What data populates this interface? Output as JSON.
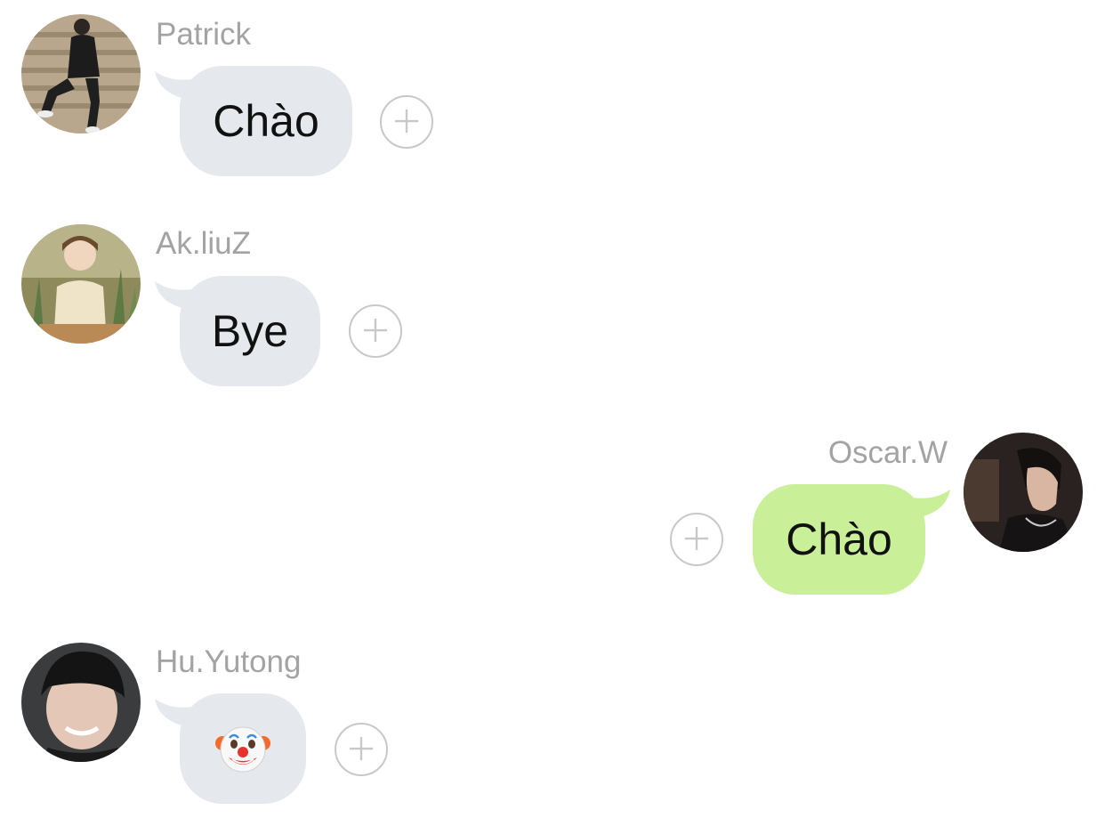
{
  "colors": {
    "incoming_bubble": "#e5e8ec",
    "outgoing_bubble": "#c9ef98",
    "sender_name": "#a3a3a3",
    "add_reaction_ring": "#c8c8c8"
  },
  "messages": [
    {
      "sender": "Patrick",
      "text": "Chào",
      "direction": "incoming",
      "avatar": "avatar-photo",
      "action_icon": "plus-circle-icon"
    },
    {
      "sender": "Ak.liuZ",
      "text": "Bye",
      "direction": "incoming",
      "avatar": "avatar-photo",
      "action_icon": "plus-circle-icon"
    },
    {
      "sender": "Oscar.W",
      "text": "Chào",
      "direction": "outgoing",
      "avatar": "avatar-photo",
      "action_icon": "plus-circle-icon"
    },
    {
      "sender": "Hu.Yutong",
      "text": "🤡",
      "direction": "incoming",
      "avatar": "avatar-photo",
      "emoji": "clown-face-emoji",
      "action_icon": "plus-circle-icon"
    }
  ]
}
